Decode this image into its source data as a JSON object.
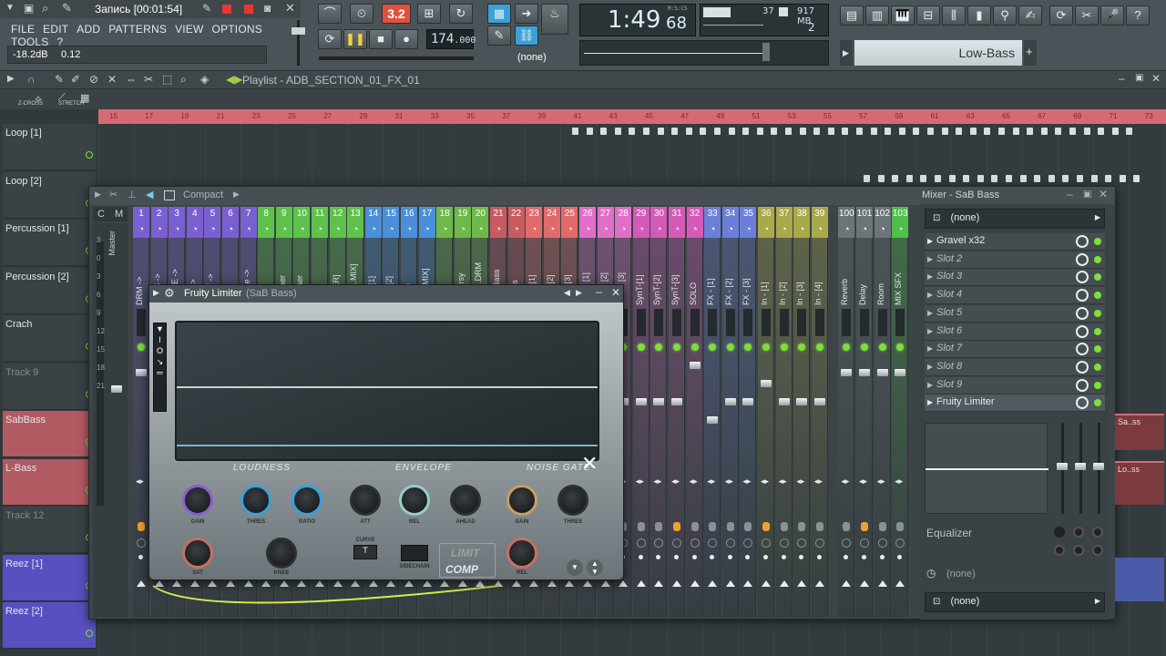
{
  "titlebar": {
    "recording": "Запись [00:01:54]"
  },
  "menu": [
    "FILE",
    "EDIT",
    "ADD",
    "PATTERNS",
    "VIEW",
    "OPTIONS",
    "TOOLS",
    "?"
  ],
  "hint": {
    "db": "-18.2dB",
    "val": "0.12"
  },
  "transport": {
    "pat_song": "3.2",
    "tempo": "174",
    "tempo_dec": ".000",
    "time": "1:49",
    "time_sub": "68",
    "time_label": "M:S:CS",
    "none_label": "(none)"
  },
  "monitor": {
    "cpu": "37",
    "ram": "917 MB",
    "poly": "2"
  },
  "hintbar": {
    "text": "Low-Bass"
  },
  "playlist": {
    "title": "Playlist - ADB_SECTION_01_FX_01",
    "zcross": "Z-CROSS",
    "stretch": "STRETCH"
  },
  "ruler": [
    "15",
    "17",
    "19",
    "21",
    "23",
    "25",
    "27",
    "29",
    "31",
    "33",
    "35",
    "37",
    "39",
    "41",
    "43",
    "45",
    "47",
    "49",
    "51",
    "53",
    "55",
    "57",
    "59",
    "61",
    "63",
    "65",
    "67",
    "69",
    "71",
    "73"
  ],
  "tracks": [
    {
      "name": "Loop [1]"
    },
    {
      "name": "Loop [2]"
    },
    {
      "name": "Percussion [1]"
    },
    {
      "name": "Percussion [2]"
    },
    {
      "name": "Crach"
    },
    {
      "name": "Track 9"
    },
    {
      "name": "SabBass"
    },
    {
      "name": "L-Bass"
    },
    {
      "name": "Track 12"
    },
    {
      "name": "Reez [1]"
    },
    {
      "name": "Reez [2]"
    }
  ],
  "mixer": {
    "compact_label": "Compact",
    "title": "Mixer - SaB Bass",
    "cm": [
      "C",
      "M"
    ],
    "master_label": "Master",
    "scale": [
      "3",
      "0",
      "3",
      "6",
      "9",
      "12",
      "15",
      "18",
      "21"
    ],
    "strips": [
      {
        "n": "1",
        "name": "DRM ->",
        "color": "#7a5fd0"
      },
      {
        "n": "2",
        "name": "BASS ->",
        "color": "#7a5fd0"
      },
      {
        "n": "3",
        "name": "LEASE ->",
        "color": "#7a5fd0"
      },
      {
        "n": "4",
        "name": "PAD ->",
        "color": "#7a5fd0"
      },
      {
        "n": "5",
        "name": "SYNT ->",
        "color": "#7a5fd0"
      },
      {
        "n": "6",
        "name": "FX ->",
        "color": "#7a5fd0"
      },
      {
        "n": "7",
        "name": "Sam..e ->",
        "color": "#7a5fd0"
      },
      {
        "n": "8",
        "name": "Kick",
        "color": "#5ec24a"
      },
      {
        "n": "9",
        "name": "A-Snaer",
        "color": "#5ec24a"
      },
      {
        "n": "10",
        "name": "B-Snaer",
        "color": "#5ec24a"
      },
      {
        "n": "11",
        "name": "Noise",
        "color": "#5ec24a"
      },
      {
        "n": "12",
        "name": "SNAER]",
        "color": "#5ec24a"
      },
      {
        "n": "13",
        "name": "[DRU..MIX]",
        "color": "#5ec24a"
      },
      {
        "n": "14",
        "name": "Hat - [1]",
        "color": "#4a8fd8"
      },
      {
        "n": "15",
        "name": "Hat - [2]",
        "color": "#4a8fd8"
      },
      {
        "n": "16",
        "name": "Crash",
        "color": "#4a8fd8"
      },
      {
        "n": "17",
        "name": "[HAT MIX]",
        "color": "#4a8fd8"
      },
      {
        "n": "18",
        "name": "Loop",
        "color": "#6fb84a"
      },
      {
        "n": "19",
        "name": "Percursy",
        "color": "#6fb84a"
      },
      {
        "n": "20",
        "name": "[Brea..DRM",
        "color": "#6fb84a"
      },
      {
        "n": "21",
        "name": "SaB Bass",
        "color": "#c85a62"
      },
      {
        "n": "22",
        "name": "L-Bass",
        "color": "#c85a62"
      },
      {
        "n": "23",
        "name": "Reas.[1]",
        "color": "#e36a6a"
      },
      {
        "n": "24",
        "name": "Reas.[2]",
        "color": "#e36a6a"
      },
      {
        "n": "25",
        "name": "Reas.[3]",
        "color": "#e36a6a"
      },
      {
        "n": "26",
        "name": "PAD - [1]",
        "color": "#e06fc8"
      },
      {
        "n": "27",
        "name": "PAD - [2]",
        "color": "#e06fc8"
      },
      {
        "n": "28",
        "name": "PAD - [3]",
        "color": "#e06fc8"
      },
      {
        "n": "29",
        "name": "SynT-[1]",
        "color": "#d45ab8"
      },
      {
        "n": "30",
        "name": "SynT-[2]",
        "color": "#d45ab8"
      },
      {
        "n": "31",
        "name": "SynT-[3]",
        "color": "#d45ab8"
      },
      {
        "n": "32",
        "name": "SOLO",
        "color": "#d45ab8"
      },
      {
        "n": "33",
        "name": "FX - [1]",
        "color": "#6b7fd8"
      },
      {
        "n": "34",
        "name": "FX - [2]",
        "color": "#6b7fd8"
      },
      {
        "n": "35",
        "name": "FX - [3]",
        "color": "#6b7fd8"
      },
      {
        "n": "36",
        "name": "In - [1]",
        "color": "#a9a94a"
      },
      {
        "n": "37",
        "name": "In - [2]",
        "color": "#a9a94a"
      },
      {
        "n": "38",
        "name": "In - [3]",
        "color": "#a9a94a"
      },
      {
        "n": "39",
        "name": "In - [4]",
        "color": "#a9a94a"
      },
      {
        "n": "100",
        "name": "Reverb",
        "color": "#6c7478"
      },
      {
        "n": "101",
        "name": "Delay",
        "color": "#6c7478"
      },
      {
        "n": "102",
        "name": "Room",
        "color": "#6c7478"
      },
      {
        "n": "103",
        "name": "MIX SFX",
        "color": "#4fbf4a"
      }
    ],
    "input_select": "(none)",
    "slots": [
      "Gravel x32",
      "Slot 2",
      "Slot 3",
      "Slot 4",
      "Slot 5",
      "Slot 6",
      "Slot 7",
      "Slot 8",
      "Slot 9",
      "Fruity Limiter"
    ],
    "equalizer": "Equalizer",
    "out1": "(none)",
    "out2": "(none)"
  },
  "plugin": {
    "title": "Fruity Limiter",
    "subtitle": "(SaB Bass)",
    "tabs": [
      "LOUDNESS",
      "ENVELOPE",
      "NOISE GATE"
    ],
    "knobs": [
      "GAIN",
      "THRES",
      "RATIO",
      "ATT",
      "REL",
      "AHEAD",
      "GAIN",
      "THRES",
      "SAT",
      "KNEE",
      "REL"
    ],
    "curve_label": "CURVE",
    "sidechain_label": "SIDECHAIN",
    "mode_limit": "LIMIT",
    "mode_comp": "COMP"
  },
  "rside": [
    "Sa..ss",
    "Lo..ss"
  ]
}
